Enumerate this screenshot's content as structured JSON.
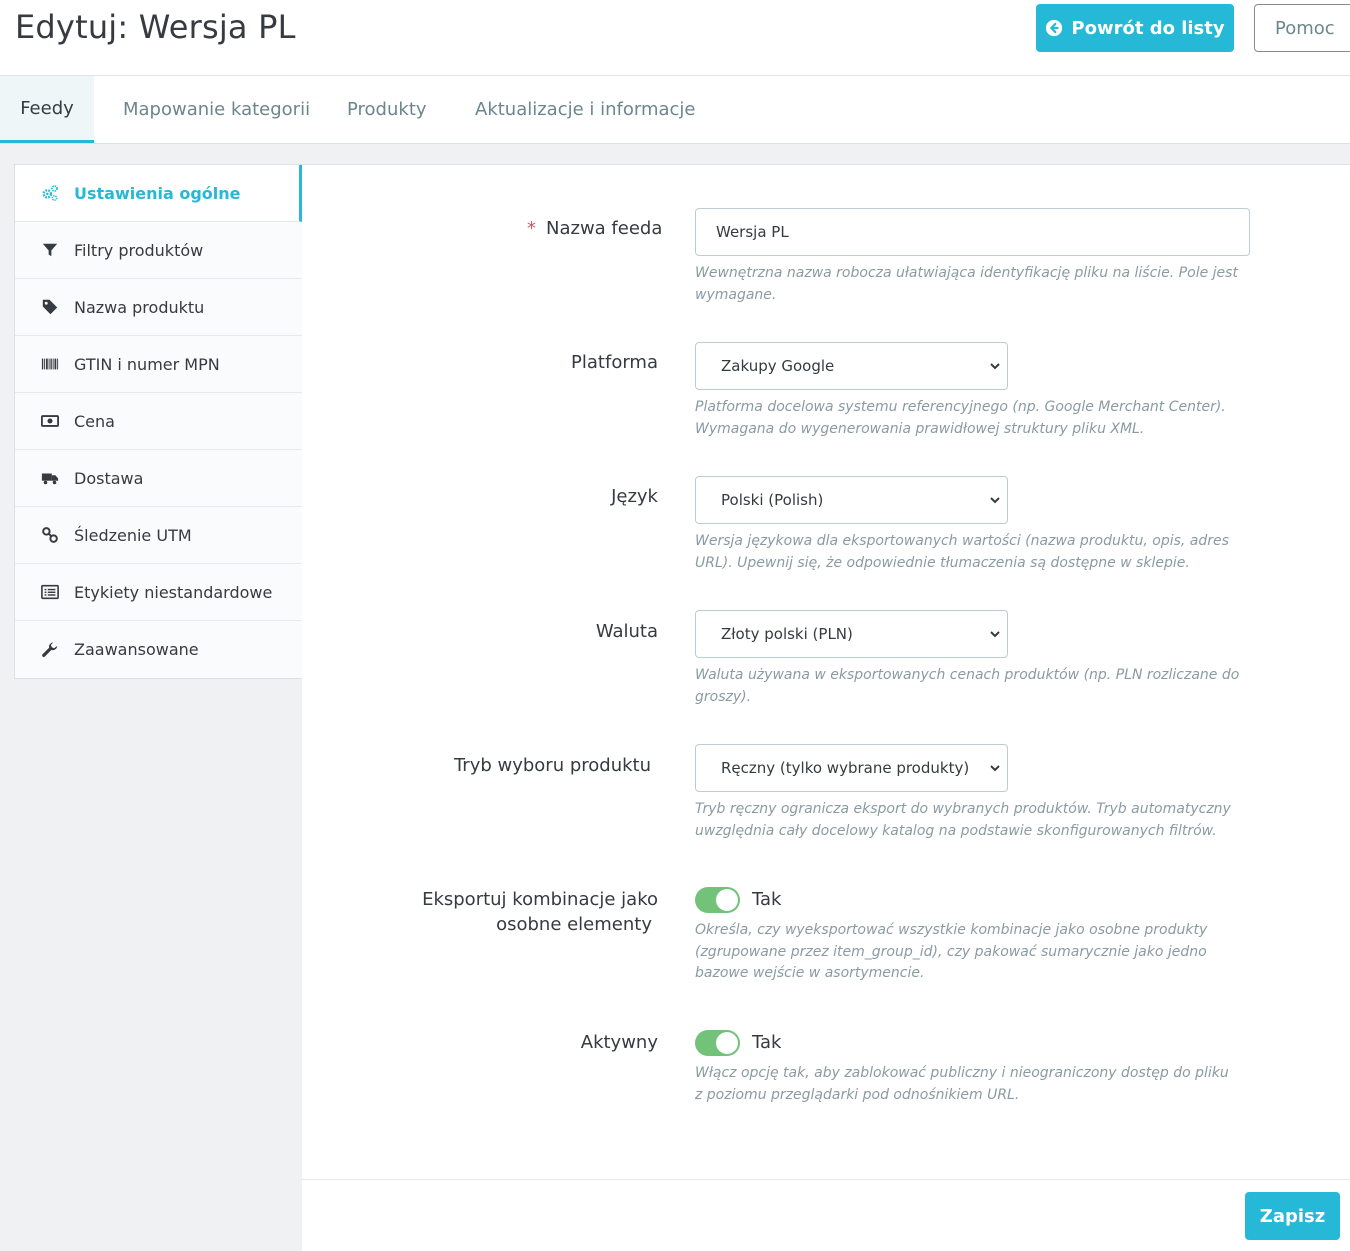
{
  "header": {
    "title": "Edytuj: Wersja PL",
    "back_label": "Powrót do listy",
    "help_label": "Pomoc"
  },
  "tabs": [
    {
      "label": "Feedy",
      "active": true
    },
    {
      "label": "Mapowanie kategorii",
      "active": false
    },
    {
      "label": "Produkty",
      "active": false
    },
    {
      "label": "Aktualizacje i informacje",
      "active": false
    }
  ],
  "sidebar": {
    "items": [
      {
        "label": "Ustawienia ogólne",
        "icon": "cogs-icon",
        "active": true
      },
      {
        "label": "Filtry produktów",
        "icon": "filter-icon"
      },
      {
        "label": "Nazwa produktu",
        "icon": "tag-icon"
      },
      {
        "label": "GTIN i numer MPN",
        "icon": "barcode-icon"
      },
      {
        "label": "Cena",
        "icon": "money-icon"
      },
      {
        "label": "Dostawa",
        "icon": "truck-icon"
      },
      {
        "label": "Śledzenie UTM",
        "icon": "link-icon"
      },
      {
        "label": "Etykiety niestandardowe",
        "icon": "list-icon"
      },
      {
        "label": "Zaawansowane",
        "icon": "wrench-icon"
      }
    ]
  },
  "form": {
    "feed_name": {
      "required_mark": "*",
      "label": "Nazwa feeda",
      "value": "Wersja PL",
      "help": "Wewnętrzna nazwa robocza ułatwiająca identyfikację pliku na liście. Pole jest wymagane."
    },
    "platform": {
      "label": "Platforma",
      "value": "Zakupy Google",
      "help": "Platforma docelowa systemu referencyjnego (np. Google Merchant Center). Wymagana do wygenerowania prawidłowej struktury pliku XML."
    },
    "language": {
      "label": "Język",
      "value": "Polski (Polish)",
      "help": "Wersja językowa dla eksportowanych wartości (nazwa produktu, opis, adres URL). Upewnij się, że odpowiednie tłumaczenia są dostępne w sklepie."
    },
    "currency": {
      "label": "Waluta",
      "value": "Złoty polski (PLN)",
      "help": "Waluta używana w eksportowanych cenach produktów (np. PLN rozliczane do groszy)."
    },
    "selection_mode": {
      "label": "Tryb wyboru produktu",
      "value": "Ręczny (tylko wybrane produkty)",
      "help": "Tryb ręczny ogranicza eksport do wybranych produktów. Tryb automatyczny uwzględnia cały docelowy katalog na podstawie skonfigurowanych filtrów."
    },
    "export_combinations": {
      "label_line1": "Eksportuj kombinacje jako",
      "label_line2": "osobne elementy",
      "state_label": "Tak",
      "on": true,
      "help": "Określa, czy wyeksportować wszystkie kombinacje jako osobne produkty (zgrupowane przez item_group_id), czy pakować sumarycznie jako jedno bazowe wejście w asortymencie."
    },
    "active": {
      "label": "Aktywny",
      "state_label": "Tak",
      "on": true,
      "help": "Włącz opcję tak, aby zablokować publiczny i nieograniczony dostęp do pliku z poziomu przeglądarki pod odnośnikiem URL."
    }
  },
  "footer": {
    "save_label": "Zapisz"
  },
  "colors": {
    "accent": "#25b9d7",
    "switch_on": "#72c279",
    "required": "#c05c67"
  }
}
